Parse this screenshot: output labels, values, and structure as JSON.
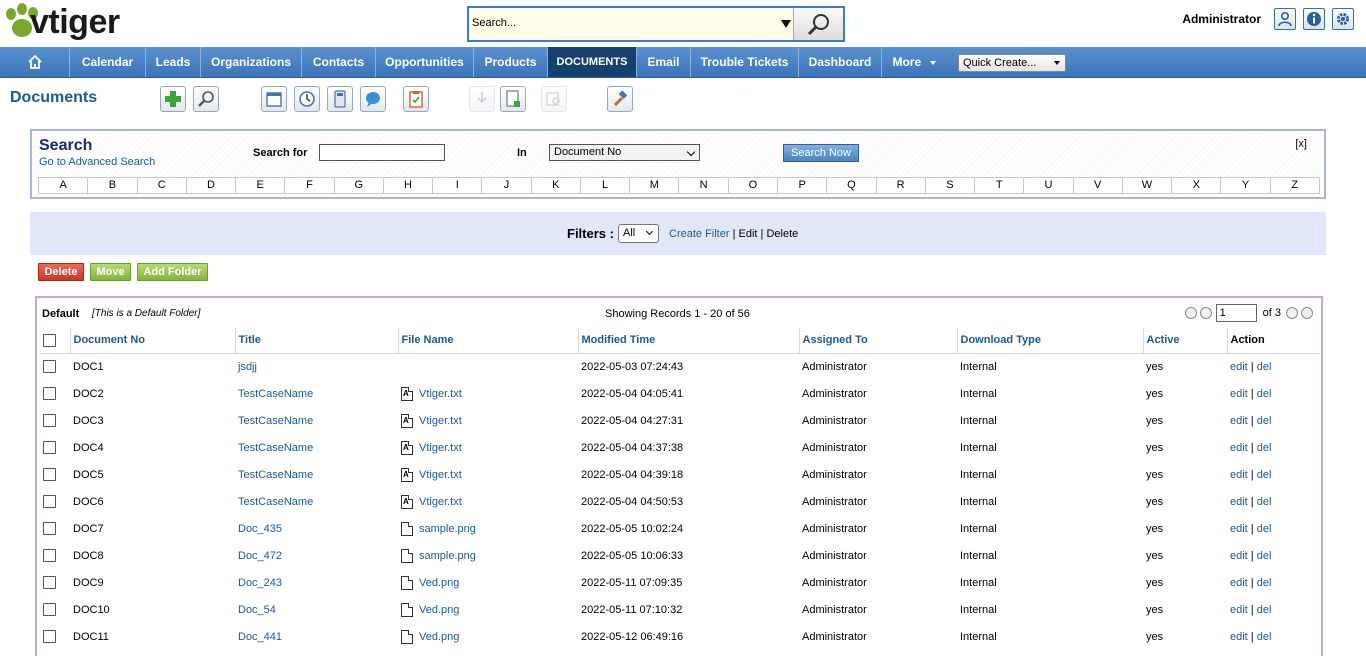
{
  "header": {
    "logo_text": "vtiger",
    "search_placeholder": "Search...",
    "user_name": "Administrator",
    "icons": [
      "user-icon",
      "info-icon",
      "settings-gear-icon"
    ]
  },
  "nav": {
    "tabs": [
      "Calendar",
      "Leads",
      "Organizations",
      "Contacts",
      "Opportunities",
      "Products",
      "DOCUMENTS",
      "Email",
      "Trouble Tickets",
      "Dashboard",
      "More"
    ],
    "active_tab": "DOCUMENTS",
    "quick_create": "Quick Create..."
  },
  "module": {
    "title": "Documents",
    "toolbar_icons": [
      "add-icon",
      "search-icon",
      "calendar-icon",
      "clock-icon",
      "calculator-icon",
      "chat-icon",
      "clipboard-icon",
      "import-icon",
      "export-icon",
      "find-duplicates-icon",
      "settings-tool-icon"
    ]
  },
  "search": {
    "title": "Search",
    "advanced_link": "Go to Advanced Search",
    "search_for_label": "Search for",
    "in_label": "In",
    "in_selected": "Document No",
    "button": "Search Now",
    "close": "[x]",
    "letters": [
      "A",
      "B",
      "C",
      "D",
      "E",
      "F",
      "G",
      "H",
      "I",
      "J",
      "K",
      "L",
      "M",
      "N",
      "O",
      "P",
      "Q",
      "R",
      "S",
      "T",
      "U",
      "V",
      "W",
      "X",
      "Y",
      "Z"
    ]
  },
  "filters": {
    "label": "Filters :",
    "selected": "All",
    "create": "Create Filter",
    "edit": "Edit",
    "delete": "Delete",
    "sep": "|"
  },
  "actions": {
    "delete": "Delete",
    "move": "Move",
    "add_folder": "Add Folder"
  },
  "list": {
    "folder": "Default",
    "folder_note": "[This is a Default Folder]",
    "records": "Showing Records 1 - 20 of 56",
    "page_value": "1",
    "page_of": "of 3",
    "columns": [
      "Document No",
      "Title",
      "File Name",
      "Modified Time",
      "Assigned To",
      "Download Type",
      "Active",
      "Action"
    ],
    "edit_label": "edit",
    "del_label": "del",
    "rows": [
      {
        "no": "DOC1",
        "title": "jsdjj",
        "file": "",
        "ftype": "",
        "mod": "2022-05-03 07:24:43",
        "assigned": "Administrator",
        "dl": "Internal",
        "active": "yes"
      },
      {
        "no": "DOC2",
        "title": "TestCaseName",
        "file": "Vtiger.txt",
        "ftype": "txt",
        "mod": "2022-05-04 04:05:41",
        "assigned": "Administrator",
        "dl": "Internal",
        "active": "yes"
      },
      {
        "no": "DOC3",
        "title": "TestCaseName",
        "file": "Vtiger.txt",
        "ftype": "txt",
        "mod": "2022-05-04 04:27:31",
        "assigned": "Administrator",
        "dl": "Internal",
        "active": "yes"
      },
      {
        "no": "DOC4",
        "title": "TestCaseName",
        "file": "Vtiger.txt",
        "ftype": "txt",
        "mod": "2022-05-04 04:37:38",
        "assigned": "Administrator",
        "dl": "Internal",
        "active": "yes"
      },
      {
        "no": "DOC5",
        "title": "TestCaseName",
        "file": "Vtiger.txt",
        "ftype": "txt",
        "mod": "2022-05-04 04:39:18",
        "assigned": "Administrator",
        "dl": "Internal",
        "active": "yes"
      },
      {
        "no": "DOC6",
        "title": "TestCaseName",
        "file": "Vtiger.txt",
        "ftype": "txt",
        "mod": "2022-05-04 04:50:53",
        "assigned": "Administrator",
        "dl": "Internal",
        "active": "yes"
      },
      {
        "no": "DOC7",
        "title": "Doc_435",
        "file": "sample.png",
        "ftype": "png",
        "mod": "2022-05-05 10:02:24",
        "assigned": "Administrator",
        "dl": "Internal",
        "active": "yes"
      },
      {
        "no": "DOC8",
        "title": "Doc_472",
        "file": "sample.png",
        "ftype": "png",
        "mod": "2022-05-05 10:06:33",
        "assigned": "Administrator",
        "dl": "Internal",
        "active": "yes"
      },
      {
        "no": "DOC9",
        "title": "Doc_243",
        "file": "Ved.png",
        "ftype": "png",
        "mod": "2022-05-11 07:09:35",
        "assigned": "Administrator",
        "dl": "Internal",
        "active": "yes"
      },
      {
        "no": "DOC10",
        "title": "Doc_54",
        "file": "Ved.png",
        "ftype": "png",
        "mod": "2022-05-11 07:10:32",
        "assigned": "Administrator",
        "dl": "Internal",
        "active": "yes"
      },
      {
        "no": "DOC11",
        "title": "Doc_441",
        "file": "Ved.png",
        "ftype": "png",
        "mod": "2022-05-12 06:49:16",
        "assigned": "Administrator",
        "dl": "Internal",
        "active": "yes"
      }
    ]
  },
  "colors": {
    "nav_bg": "#3b74b9",
    "active_tab_bg": "#16416f",
    "link": "#1a5a9a",
    "filter_bar": "#e3e7fb",
    "delete_btn": "#c9372a",
    "green_btn": "#84b43a"
  }
}
